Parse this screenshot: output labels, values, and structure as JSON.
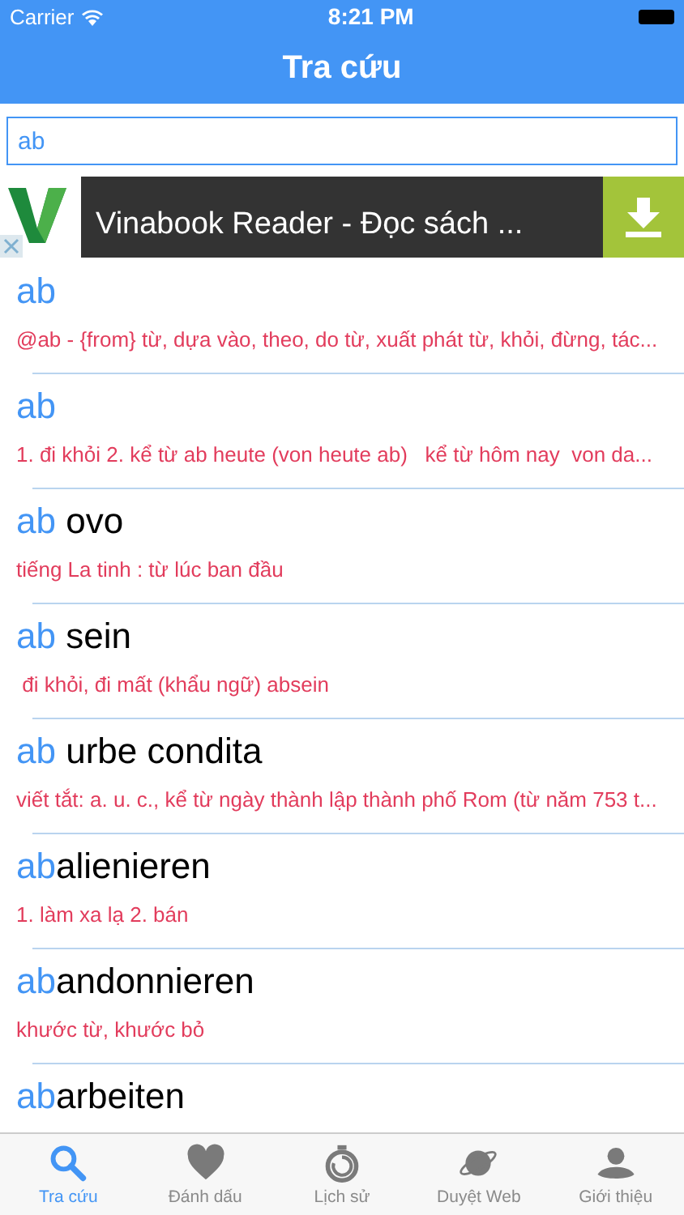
{
  "status_bar": {
    "carrier": "Carrier",
    "time": "8:21 PM"
  },
  "nav": {
    "title": "Tra cứu"
  },
  "search": {
    "value": "ab"
  },
  "ad": {
    "title": "Vinabook Reader - Đọc sách ..."
  },
  "entries": [
    {
      "match": "ab",
      "definition": "@ab - {from} từ, dựa vào, theo, do từ, xuất phát từ, khỏi, đừng, tác..."
    },
    {
      "match": "ab",
      "definition": "1. đi khỏi 2. kể từ ab heute (von heute ab)   kể từ hôm nay  von da..."
    },
    {
      "match": "ab",
      "rest": "ovo",
      "gap": true,
      "definition": "tiếng La tinh : từ lúc ban đầu"
    },
    {
      "match": "ab",
      "rest": "sein",
      "gap": true,
      "definition": " đi khỏi, đi mất (khẩu ngữ) absein"
    },
    {
      "match": "ab",
      "rest": "urbe condita",
      "gap": true,
      "definition": "viết tắt: a. u. c., kể từ ngày thành lập thành phố Rom (từ năm 753 t..."
    },
    {
      "match": "ab",
      "rest": "alienieren",
      "gap": false,
      "definition": "1. làm xa lạ 2. bán"
    },
    {
      "match": "ab",
      "rest": "andonnieren",
      "gap": false,
      "definition": "khước từ, khước bỏ"
    },
    {
      "match": "ab",
      "rest": "arbeiten",
      "gap": false
    }
  ],
  "tabs": [
    {
      "kind": "search",
      "label": "Tra cứu",
      "selected": true
    },
    {
      "kind": "heart",
      "label": "Đánh dấu",
      "selected": false
    },
    {
      "kind": "stopwatch",
      "label": "Lịch sử",
      "selected": false
    },
    {
      "kind": "planet",
      "label": "Duyệt Web",
      "selected": false
    },
    {
      "kind": "person",
      "label": "Giới thiệu",
      "selected": false
    }
  ]
}
